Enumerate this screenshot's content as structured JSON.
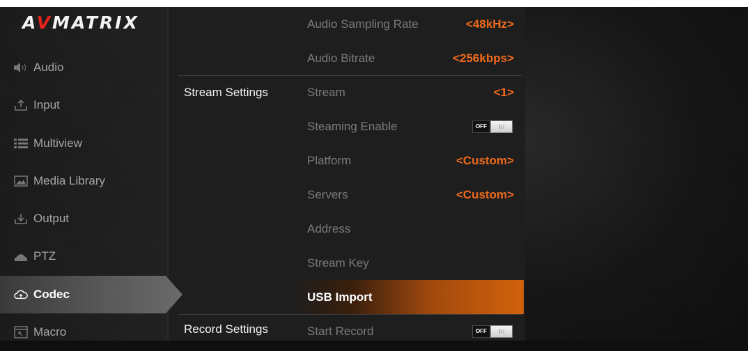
{
  "brand": {
    "logo_text_a": "A",
    "logo_text_v": "V",
    "logo_text_rest": "MATRIX"
  },
  "sidebar": {
    "items": [
      {
        "label": "Audio",
        "icon": "speaker-icon",
        "active": false
      },
      {
        "label": "Input",
        "icon": "upload-icon",
        "active": false
      },
      {
        "label": "Multiview",
        "icon": "list-icon",
        "active": false
      },
      {
        "label": "Media Library",
        "icon": "image-icon",
        "active": false
      },
      {
        "label": "Output",
        "icon": "download-icon",
        "active": false
      },
      {
        "label": "PTZ",
        "icon": "camera-icon",
        "active": false
      },
      {
        "label": "Codec",
        "icon": "cloud-icon",
        "active": true
      },
      {
        "label": "Macro",
        "icon": "macro-icon",
        "active": false
      }
    ]
  },
  "settings": {
    "audio_sampling_rate": {
      "label": "Audio Sampling Rate",
      "value": "<48kHz>"
    },
    "audio_bitrate": {
      "label": "Audio Bitrate",
      "value": "<256kbps>"
    },
    "stream_section": "Stream Settings",
    "stream": {
      "label": "Stream",
      "value": "<1>"
    },
    "streaming_enable": {
      "label": "Steaming Enable",
      "toggle": "OFF"
    },
    "platform": {
      "label": "Platform",
      "value": "<Custom>"
    },
    "servers": {
      "label": "Servers",
      "value": "<Custom>"
    },
    "address": {
      "label": "Address"
    },
    "stream_key": {
      "label": "Stream Key"
    },
    "usb_import": {
      "label": "USB Import"
    },
    "record_section": "Record Settings",
    "start_record": {
      "label": "Start Record",
      "toggle": "OFF"
    }
  },
  "colors": {
    "accent": "#f06a1c",
    "highlight": "#d2620c",
    "logo_v": "#e2231a"
  }
}
